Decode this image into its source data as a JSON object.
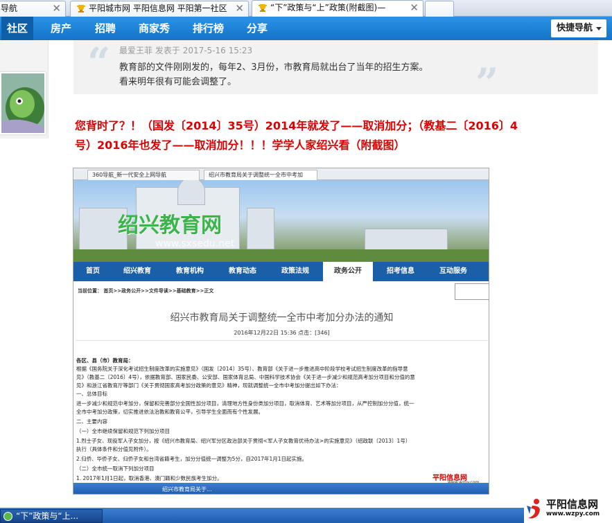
{
  "browser_tabs": [
    {
      "label": "导航",
      "icon": "none"
    },
    {
      "label": "平阳城市网 平阳信息网 平阳第一社区",
      "icon": "trophy-icon"
    },
    {
      "label": "“下”政策与“上”政策(附截图)—",
      "icon": "trophy-icon"
    }
  ],
  "nav": {
    "items": [
      "社区",
      "房产",
      "招聘",
      "商家秀",
      "排行榜",
      "分享"
    ],
    "active": "社区",
    "quick_nav": "快捷导航"
  },
  "quote": {
    "author": "最爱王菲",
    "posted": "发表于",
    "time": "2017-5-16 15:23",
    "lines": [
      "教育部的文件刚刚发的，每年2、3月份，市教育局就出台了当年的招生方案。",
      "看来明年很有可能会调整了。"
    ]
  },
  "headline": {
    "line1": "您背时了？！（国发〔2014〕35号）2014年就发了——取消加分；（教基二〔2016〕4",
    "line2": "号）2016年也发了——取消加分！！！学学人家绍兴看（附截图）"
  },
  "screenshot": {
    "tabs": [
      "360导航_新一代安全上网导航",
      "绍兴市教育局关于调整统一全市中考加"
    ],
    "banner_logo": "绍兴教育网",
    "banner_url": "www.sxsedu.net",
    "nav": [
      "首页",
      "绍兴教育",
      "教育机构",
      "教育动态",
      "政策法规",
      "政务公开",
      "招考信息",
      "互动服务"
    ],
    "nav_active": "政务公开",
    "breadcrumb": "当前位置： 首页>>政务公开>>文件导读>>基础教育>>正文",
    "title": "绍兴市教育局关于调整统一全市中考加分办法的通知",
    "date": "2016年12月22日 15:36  点击：[346]",
    "body": [
      "各区、县（市）教育局：",
      "    根据《国务院关于深化考试招生制度改革的实施意见》（国发〔2014〕35号）、教育部《关于进一步推进高中阶段学校考试招生制度改革的指导意",
      "见》（教基二〔2016〕4号），依据教育部、国家民委、公安部、国家体育总局、中国科学技术协会《关于进一步减少和规范高考加分项目和分值的意",
      "见》和浙江省教育厅等部门《关于贯彻国家高考加分政策的意见》精神，现就调整统一全市中考加分提出如下办法：",
      "    一、总体目标",
      "    进一步减少和规范中考加分，保留和完善部分全国性加分项目，清理地方性身份类加分项目，取消体育、艺术等加分项目，从严控制加分分值，统一",
      "全市中考加分政策，切实推进依法治教和教育公平，引导学生全面而有个性发展。",
      "    二、主要内容",
      "    （一）全市继续保留和规范下列加分项目",
      "    1.烈士子女、现役军人子女加分，按《绍兴市教育局、绍兴军分区政治部关于贯彻<军人子女教育优待办法>的实施意见》（绍政联〔2013〕1号）",
      "执行（具体条件和分值见附件）。",
      "    2.归侨、华侨子女、归侨子女和台湾省籍考生，加分分值统一调整为5分，自2017年1月1日起实施。",
      "    （二）全市统一取消下列加分项目",
      "    1. 2017年1月1日起，取消香港、澳门籍和少数民族考生加分。"
    ],
    "taskbar_text": "绍兴市教育局关于...",
    "watermark_name": "平阳信息网",
    "watermark_url": "www.wzpy.com"
  },
  "taskbar": {
    "button": "“下”政策与“上...",
    "brand_name": "平阳信息网",
    "brand_url": "www.wzpy.com"
  },
  "colors": {
    "nav_blue": "#1d84d8",
    "headline_red": "#dd0000",
    "quote_bg": "#f2f2f2"
  }
}
